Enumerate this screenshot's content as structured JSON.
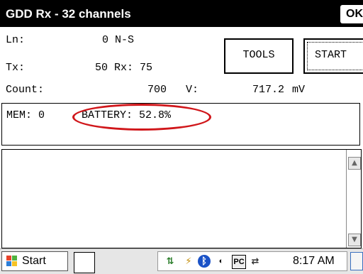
{
  "window": {
    "title": "GDD Rx - 32 channels",
    "ok_label": "OK"
  },
  "fields": {
    "ln_label": "Ln:",
    "ln_value": "0 N-S",
    "tx_label": "Tx:",
    "tx_value": "50 Rx: 75",
    "count_label": "Count:",
    "count_value": "700",
    "v_label": "V:",
    "v_value": "717.2",
    "v_unit": "mV"
  },
  "buttons": {
    "tools": "TOOLS",
    "start": "START"
  },
  "status": {
    "mem": "MEM: 0",
    "battery": "BATTERY: 52.8%"
  },
  "taskbar": {
    "start_label": "Start",
    "clock": "8:17 AM",
    "pc_label": "PC"
  },
  "colors": {
    "titlebar": "#000000",
    "highlight": "#d0161a"
  }
}
